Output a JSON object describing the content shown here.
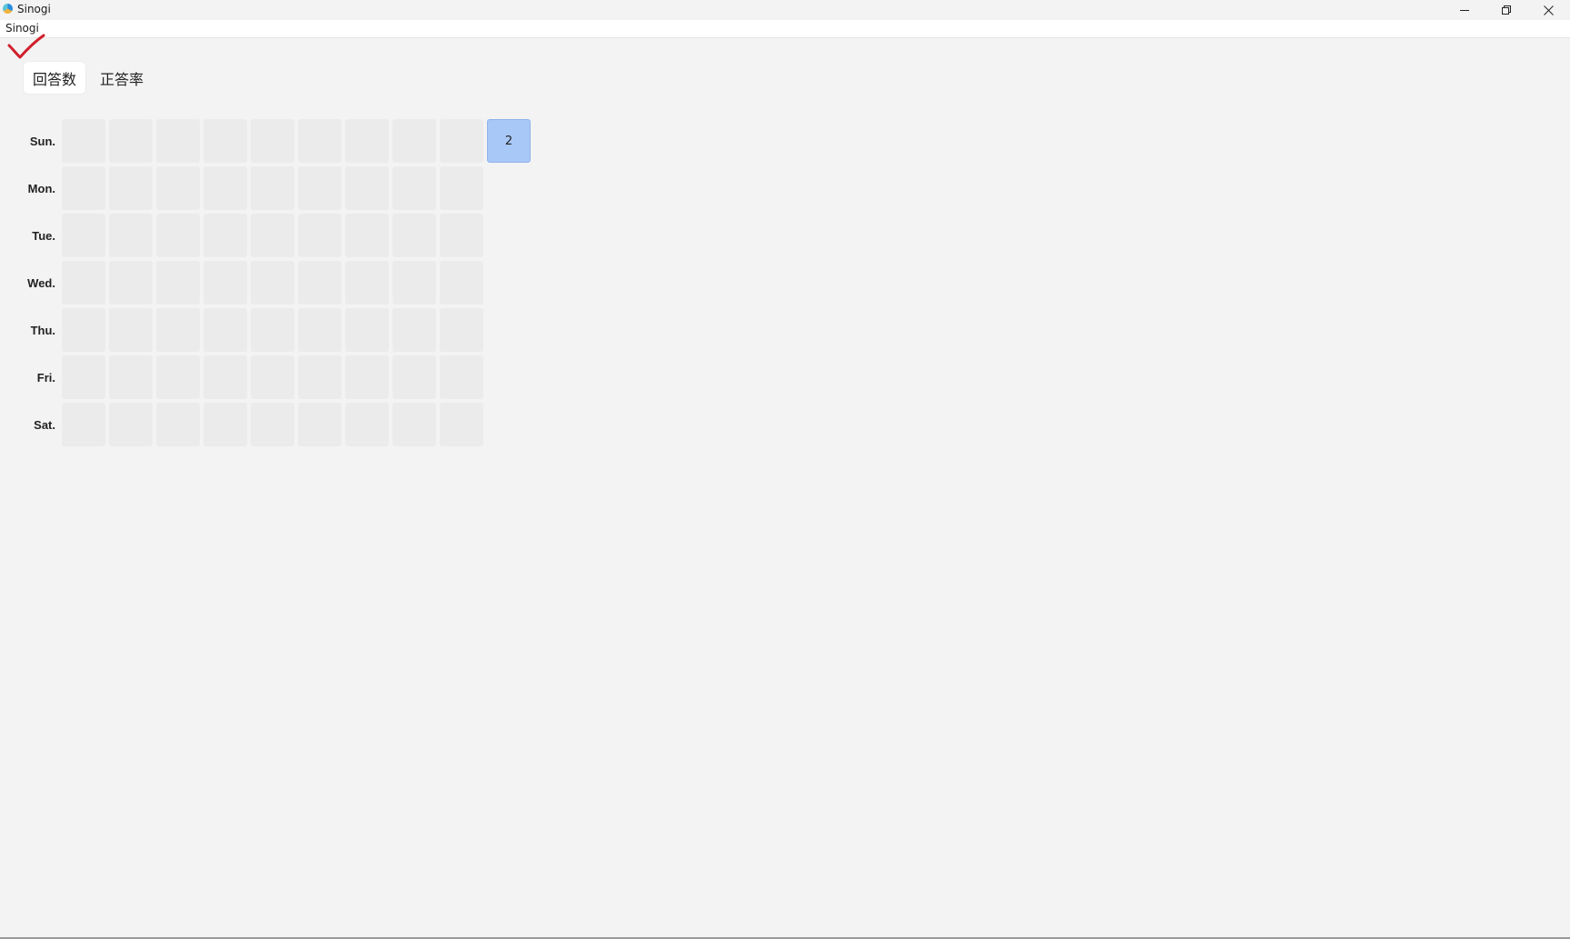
{
  "window": {
    "title": "Sinogi",
    "icon": "app-icon",
    "controls": [
      "minimize-icon",
      "restore-icon",
      "close-icon"
    ]
  },
  "menu": {
    "items": [
      "Sinogi"
    ]
  },
  "annotation": {
    "mark": "check-mark",
    "color": "#d01f2b"
  },
  "tabs": [
    {
      "label": "回答数",
      "active": true
    },
    {
      "label": "正答率",
      "active": false
    }
  ],
  "heatmap": {
    "days": [
      "Sun.",
      "Mon.",
      "Tue.",
      "Wed.",
      "Thu.",
      "Fri.",
      "Sat."
    ],
    "columns": 10,
    "rows": [
      [
        "",
        "",
        "",
        "",
        "",
        "",
        "",
        "",
        "",
        "2"
      ],
      [
        "",
        "",
        "",
        "",
        "",
        "",
        "",
        "",
        "",
        null
      ],
      [
        "",
        "",
        "",
        "",
        "",
        "",
        "",
        "",
        "",
        null
      ],
      [
        "",
        "",
        "",
        "",
        "",
        "",
        "",
        "",
        "",
        null
      ],
      [
        "",
        "",
        "",
        "",
        "",
        "",
        "",
        "",
        "",
        null
      ],
      [
        "",
        "",
        "",
        "",
        "",
        "",
        "",
        "",
        "",
        null
      ],
      [
        "",
        "",
        "",
        "",
        "",
        "",
        "",
        "",
        "",
        null
      ]
    ],
    "colors": {
      "empty_cell": "#ebebeb",
      "active_cell": "#a8c8f8"
    }
  }
}
